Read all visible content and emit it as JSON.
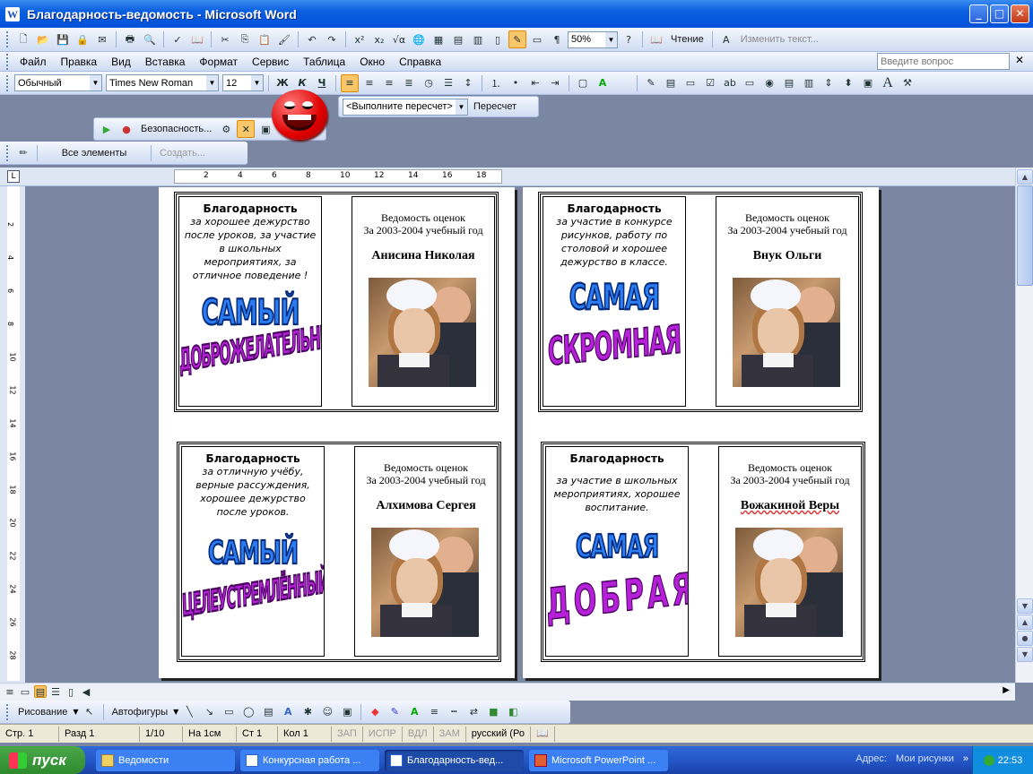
{
  "window": {
    "title": "Благодарность-ведомость - Microsoft Word"
  },
  "toolbar1": {
    "zoom": "50%",
    "reading": "Чтение",
    "change_text": "Изменить текст..."
  },
  "menu": {
    "items": [
      "Файл",
      "Правка",
      "Вид",
      "Вставка",
      "Формат",
      "Сервис",
      "Таблица",
      "Окно",
      "Справка"
    ],
    "question_placeholder": "Введите вопрос"
  },
  "format": {
    "style": "Обычный",
    "font": "Times New Roman",
    "size": "12",
    "bold": "Ж",
    "italic": "К",
    "underline": "Ч"
  },
  "recount": {
    "select": "<Выполните пересчет>",
    "button": "Пересчет"
  },
  "security": {
    "label": "Безопасность..."
  },
  "elements": {
    "all": "Все элементы",
    "create": "Создать..."
  },
  "ruler": {
    "h_ticks": [
      "2",
      "4",
      "6",
      "8",
      "10",
      "12",
      "14",
      "16",
      "18"
    ],
    "v_ticks": [
      "2",
      "4",
      "6",
      "8",
      "10",
      "12",
      "14",
      "16",
      "18",
      "20",
      "22",
      "24",
      "26",
      "28"
    ]
  },
  "cards": [
    {
      "thanks": "Благодарность",
      "text": "за хорошее дежурство после уроков, за участие в школьных мероприятиях, за отличное поведение !",
      "word1": "САМЫЙ",
      "word2": "ДОБРОЖЕЛАТЕЛЬНЫЙ",
      "ved1": "Ведомость оценок",
      "ved2": "За 2003-2004 учебный год",
      "name": "Анисина Николая"
    },
    {
      "thanks": "Благодарность",
      "text": "за участие в конкурсе рисунков, работу по столовой и хорошее дежурство в классе.",
      "word1": "САМАЯ",
      "word2": "СКРОМНАЯ",
      "ved1": "Ведомость оценок",
      "ved2": "За 2003-2004 учебный год",
      "name": "Внук Ольги"
    },
    {
      "thanks": "Благодарность",
      "text": "за отличную учёбу, верные рассуждения, хорошее дежурство после уроков.",
      "word1": "САМЫЙ",
      "word2": "ЦЕЛЕУСТРЕМЛЁННЫЙ",
      "ved1": "Ведомость оценок",
      "ved2": "За 2003-2004 учебный год",
      "name": "Алхимова Сергея"
    },
    {
      "thanks": "Благодарность",
      "text": "за участие в школьных мероприятиях, хорошее воспитание.",
      "word1": "САМАЯ",
      "word2": "ДОБРАЯ",
      "ved1": "Ведомость оценок",
      "ved2": "За 2003-2004 учебный год",
      "name": "Вожакиной Веры"
    }
  ],
  "drawing": {
    "draw": "Рисование",
    "autoshapes": "Автофигуры"
  },
  "status": {
    "page": "Стр. 1",
    "section": "Разд 1",
    "pages": "1/10",
    "at": "На 1см",
    "line": "Ст 1",
    "col": "Кол 1",
    "rec": "ЗАП",
    "trk": "ИСПР",
    "ext": "ВДЛ",
    "ovr": "ЗАМ",
    "lang": "русский (Ро"
  },
  "taskbar": {
    "start": "пуск",
    "tasks": [
      "Ведомости",
      "Конкурсная работа ...",
      "Благодарность-вед...",
      "Microsoft PowerPoint ..."
    ],
    "address_label": "Адрес:",
    "address_value": "Мои рисунки",
    "time": "22:53"
  }
}
